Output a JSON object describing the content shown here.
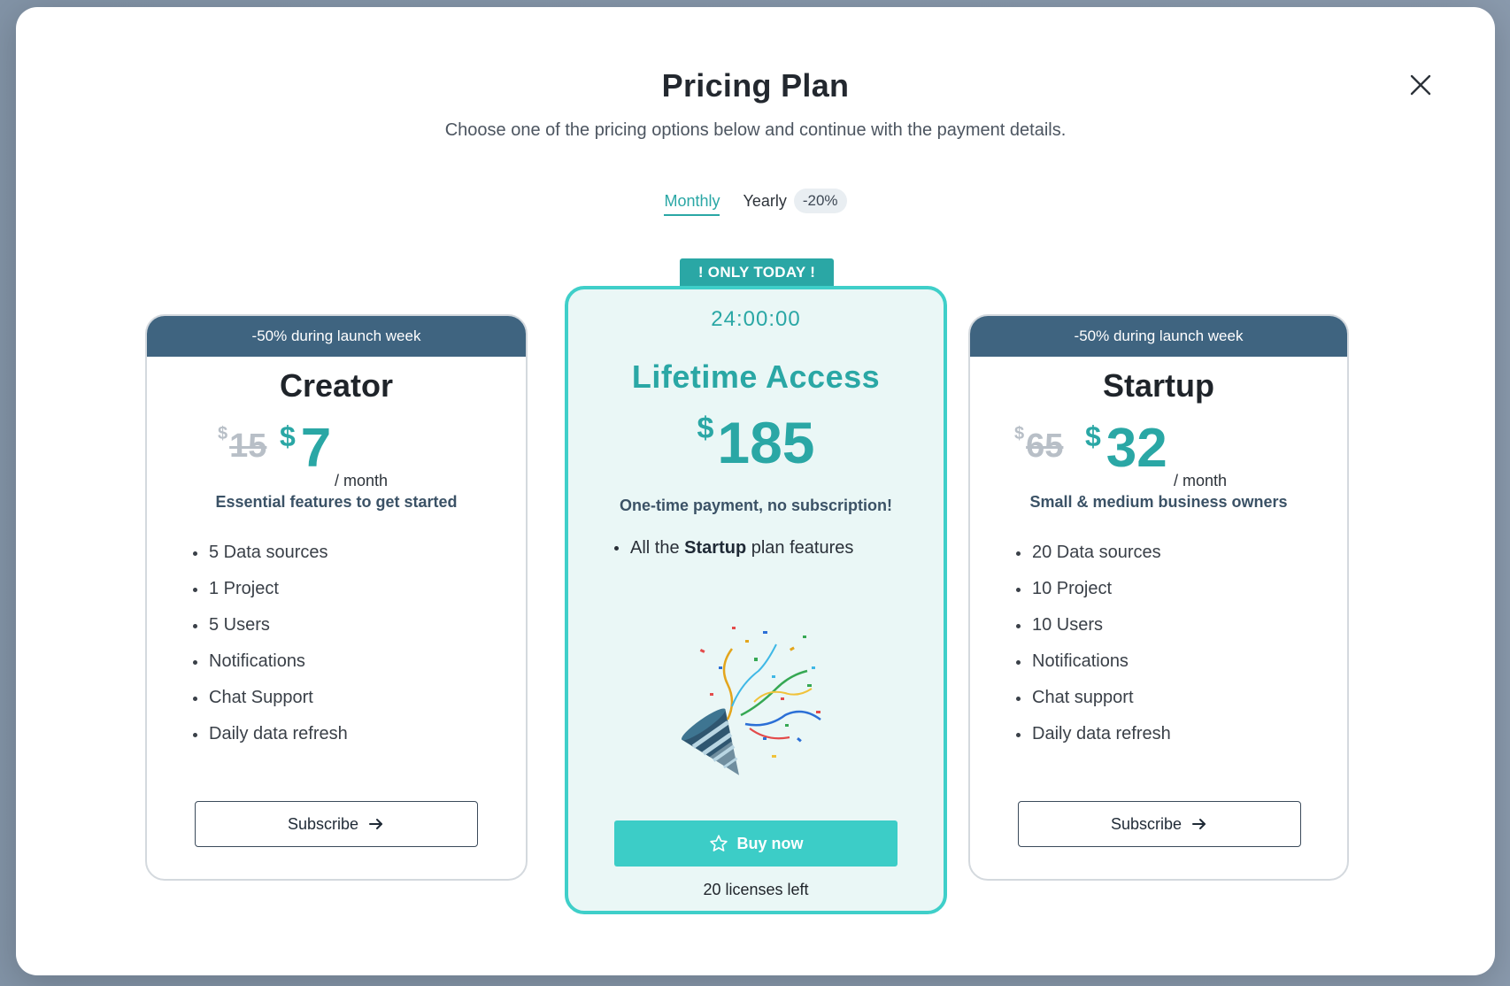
{
  "modal": {
    "title": "Pricing Plan",
    "subtitle": "Choose one of the pricing options below and continue with the payment details.",
    "close_icon": "close-icon"
  },
  "billing": {
    "monthly_label": "Monthly",
    "yearly_label": "Yearly",
    "yearly_discount": "-20%",
    "selected": "Monthly"
  },
  "plans": [
    {
      "banner": "-50% during launch week",
      "name": "Creator",
      "currency": "$",
      "old_price": "15",
      "new_price": "7",
      "period": "/ month",
      "tagline": "Essential features to get started",
      "features": [
        "5 Data sources",
        "1 Project",
        "5 Users",
        "Notifications",
        "Chat Support",
        "Daily data refresh"
      ],
      "button_label": "Subscribe",
      "button_icon": "arrow-right-icon"
    },
    {
      "ribbon": "! ONLY TODAY !",
      "timer": "24:00:00",
      "name": "Lifetime Access",
      "currency": "$",
      "price": "185",
      "tagline": "One-time payment, no subscription!",
      "feature_prefix": "All the ",
      "feature_bold": "Startup",
      "feature_suffix": " plan features",
      "illustration": "party-popper-confetti",
      "button_label": "Buy now",
      "button_icon": "star-icon",
      "licenses": "20 licenses left"
    },
    {
      "banner": "-50% during launch week",
      "name": "Startup",
      "currency": "$",
      "old_price": "65",
      "new_price": "32",
      "period": "/ month",
      "tagline": "Small & medium business owners",
      "features": [
        "20 Data sources",
        "10 Project",
        "10 Users",
        "Notifications",
        "Chat support",
        "Daily data refresh"
      ],
      "button_label": "Subscribe",
      "button_icon": "arrow-right-icon"
    }
  ],
  "colors": {
    "accent": "#2aa7a5",
    "accent_light": "#3ccdc7",
    "banner": "#3f6480",
    "mid_card_bg": "#eaf7f6"
  }
}
